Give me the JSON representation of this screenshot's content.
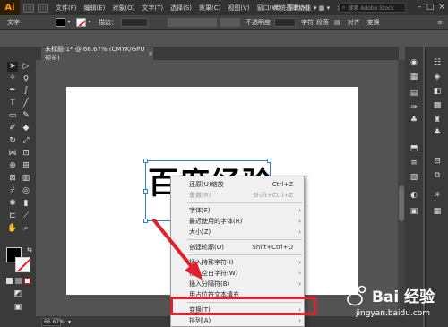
{
  "app": {
    "logo": "Ai",
    "menus": [
      "文件(F)",
      "编辑(E)",
      "对象(O)",
      "文字(T)",
      "选择(S)",
      "效果(C)",
      "视图(V)",
      "窗口(W)",
      "帮助(H)"
    ],
    "workspace": "传统基本功能",
    "search_placeholder": "搜索 Adobe Stock"
  },
  "control_bar": {
    "label": "文字",
    "stroke_label": "描边：",
    "opacity_label": "不透明度",
    "char_label": "字符",
    "para_label": "段落",
    "align_label": "对齐",
    "transform_label": "变换"
  },
  "document": {
    "tab_title": "未标题-1* @ 66.67% (CMYK/GPU 预览)",
    "text": "百度经验",
    "zoom": "66.67%"
  },
  "context_menu": {
    "items": [
      {
        "label": "还原(U)缩放",
        "shortcut": "Ctrl+Z",
        "disabled": false,
        "submenu": false
      },
      {
        "label": "重做(R)",
        "shortcut": "Shift+Ctrl+Z",
        "disabled": true,
        "submenu": false
      },
      {
        "label": "字体(F)",
        "shortcut": "",
        "disabled": false,
        "submenu": true
      },
      {
        "label": "最近使用的字体(R)",
        "shortcut": "",
        "disabled": false,
        "submenu": true
      },
      {
        "label": "大小(Z)",
        "shortcut": "",
        "disabled": false,
        "submenu": true
      },
      {
        "label": "创建轮廓(O)",
        "shortcut": "Shift+Ctrl+O",
        "disabled": false,
        "submenu": false
      },
      {
        "label": "插入特殊字符(I)",
        "shortcut": "",
        "disabled": false,
        "submenu": true
      },
      {
        "label": "插入空白字符(W)",
        "shortcut": "",
        "disabled": false,
        "submenu": true
      },
      {
        "label": "插入分隔符(B)",
        "shortcut": "",
        "disabled": false,
        "submenu": true
      },
      {
        "label": "用占位符文本填充",
        "shortcut": "",
        "disabled": false,
        "submenu": false
      },
      {
        "label": "变换(T)",
        "shortcut": "",
        "disabled": false,
        "submenu": true
      },
      {
        "label": "排列(A)",
        "shortcut": "",
        "disabled": false,
        "submenu": true
      }
    ]
  },
  "watermark": {
    "main": "Bai 经验",
    "sub": "jingyan.baidu.com"
  },
  "colors": {
    "highlight": "#e0202c",
    "arrow": "#e0202c",
    "selection": "#2e7dd7",
    "logo_text": "#ff9a00"
  }
}
